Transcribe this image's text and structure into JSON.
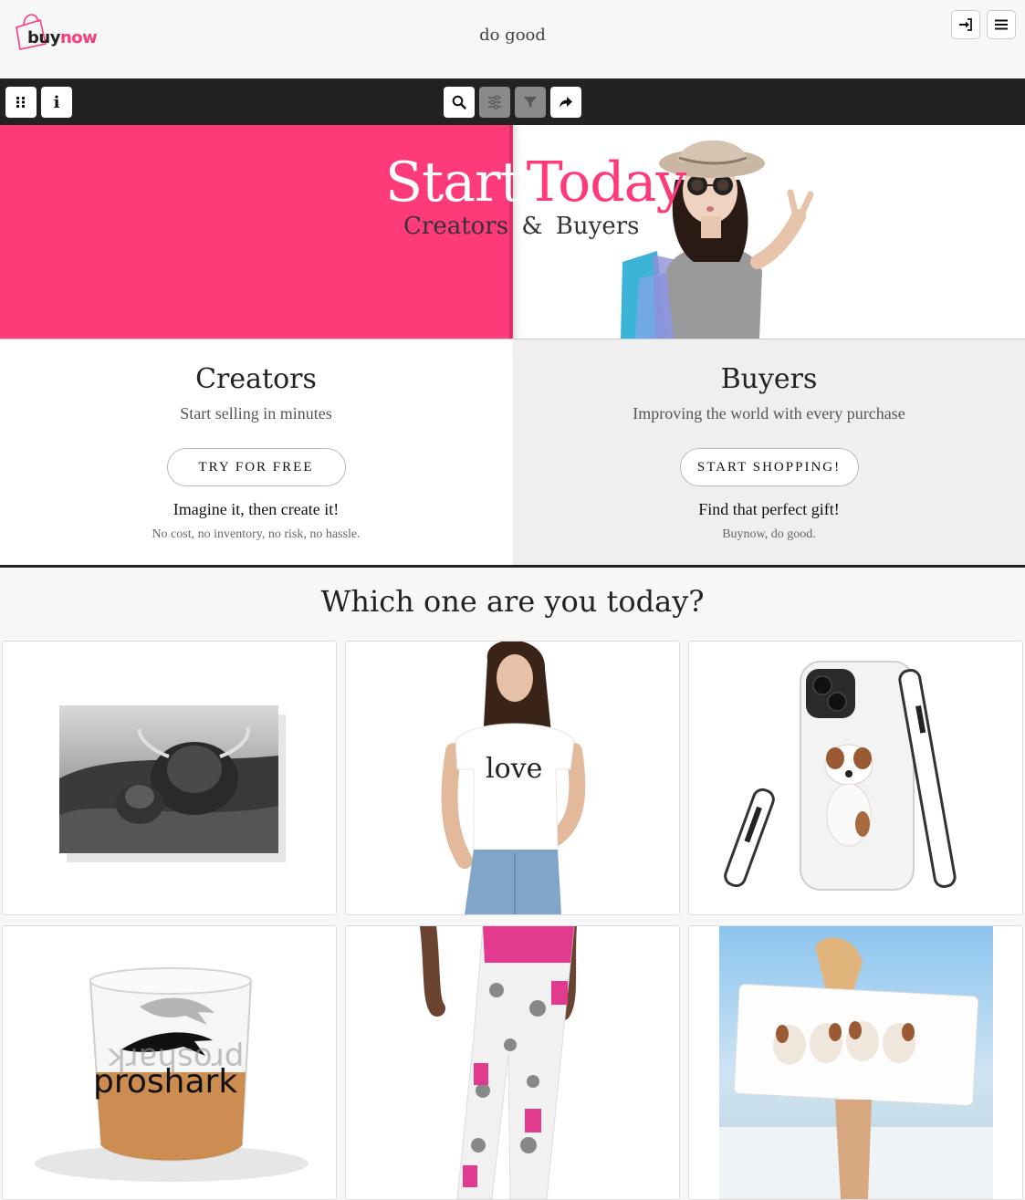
{
  "header": {
    "logo": {
      "buy": "buy",
      "now": "now"
    },
    "tagline": "do good",
    "login_icon": "sign-in-icon",
    "menu_icon": "hamburger-menu-icon"
  },
  "toolbar": {
    "left": [
      "grid-icon",
      "info-icon"
    ],
    "info_label": "i",
    "center": [
      "search-icon",
      "sliders-icon",
      "filter-icon",
      "share-icon"
    ]
  },
  "hero": {
    "title_word1": "Start",
    "title_word2": "Today",
    "subtitle_creators": "Creators",
    "subtitle_amp": "&",
    "subtitle_buyers": "Buyers"
  },
  "creators": {
    "heading": "Creators",
    "subheading": "Start selling in minutes",
    "cta_label": "TRY FOR FREE",
    "tagline": "Imagine it, then create it!",
    "note": "No cost, no inventory, no risk, no hassle."
  },
  "buyers": {
    "heading": "Buyers",
    "subheading": "Improving the world with every purchase",
    "cta_label": "START SHOPPING!",
    "tagline": "Find that perfect gift!",
    "note": "Buynow, do good."
  },
  "products": {
    "section_title": "Which one are you today?",
    "items": [
      {
        "kind": "canvas-print-highland-cow"
      },
      {
        "kind": "tshirt-love",
        "print_text": "love"
      },
      {
        "kind": "phone-case-puppy"
      },
      {
        "kind": "shot-glass-shark",
        "print_text": "proshark",
        "mirror_text": "proshark"
      },
      {
        "kind": "leggings-pink-pattern"
      },
      {
        "kind": "beach-towel-puppies"
      }
    ]
  },
  "colors": {
    "accent": "#ff3a78",
    "toolbar": "#222222",
    "panel_gray": "#efefef"
  }
}
